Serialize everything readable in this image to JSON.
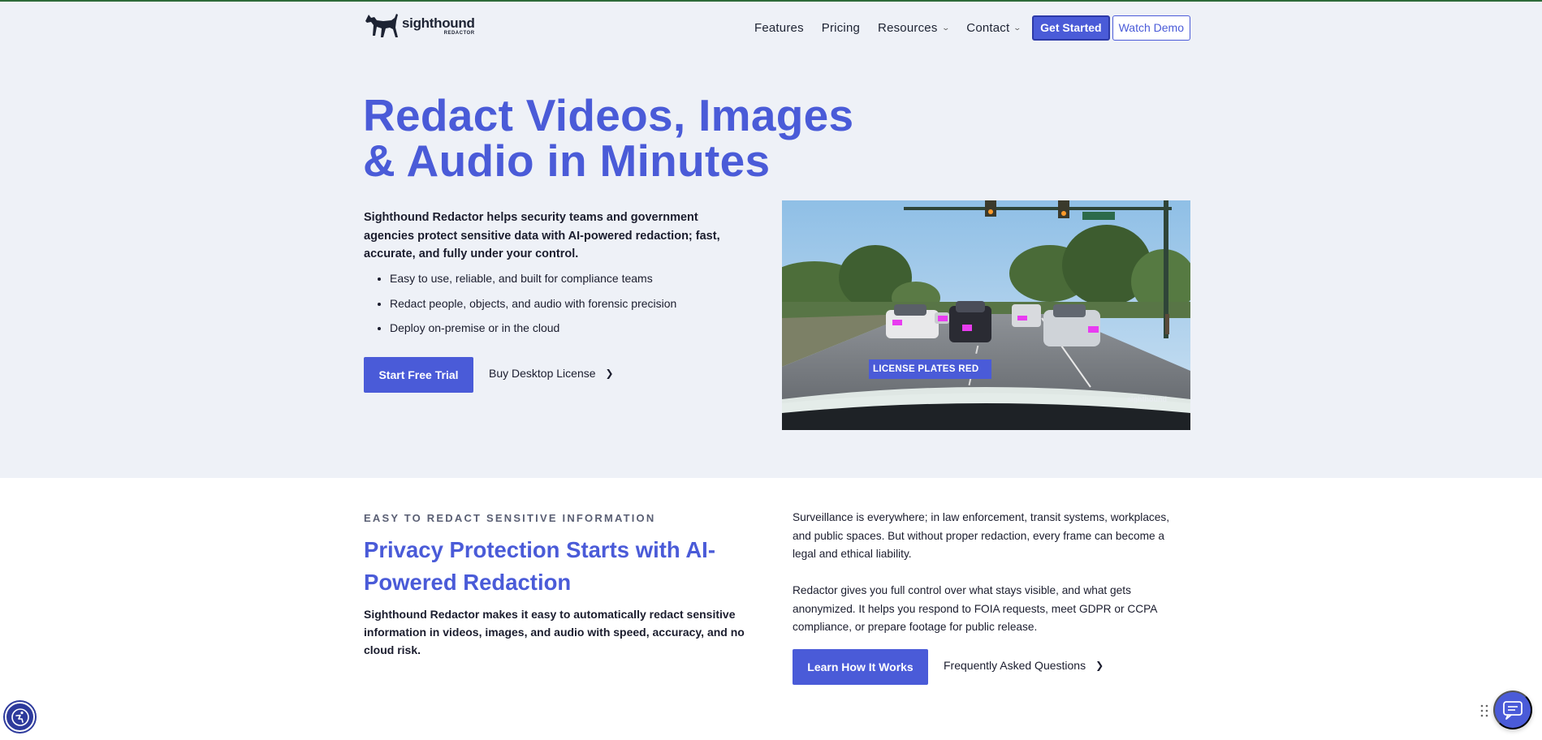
{
  "brand": {
    "name": "sighthound",
    "product": "REDACTOR",
    "logo_icon": "dog-logo-icon"
  },
  "nav": {
    "links": [
      {
        "label": "Features",
        "has_dropdown": false
      },
      {
        "label": "Pricing",
        "has_dropdown": false
      },
      {
        "label": "Resources",
        "has_dropdown": true
      },
      {
        "label": "Contact",
        "has_dropdown": true
      }
    ],
    "get_started": "Get Started",
    "watch_demo": "Watch Demo"
  },
  "hero": {
    "title_line1": "Redact Videos, Images",
    "title_line2": "& Audio in Minutes",
    "intro": "Sighthound Redactor helps security teams and government agencies protect sensitive data with AI-powered redaction; fast, accurate, and fully under your control.",
    "bullets": [
      "Easy to use, reliable, and built for compliance teams",
      "Redact people, objects, and audio with forensic precision",
      "Deploy on-premise or in the cloud"
    ],
    "primary_cta": "Start Free Trial",
    "secondary_cta": "Buy Desktop License",
    "video_caption": "LICENSE PLATES RED"
  },
  "section2": {
    "eyebrow": "EASY TO REDACT SENSITIVE INFORMATION",
    "title_line1": "Privacy Protection Starts with AI-",
    "title_line2": "Powered Redaction",
    "description": "Sighthound Redactor makes it easy to automatically redact sensitive information in videos, images, and audio with speed, accuracy, and no cloud risk.",
    "paragraph1": "Surveillance is everywhere; in law enforcement, transit systems, workplaces, and public spaces. But without proper redaction, every frame can become a legal and ethical liability.",
    "paragraph2": "Redactor gives you full control over what stays visible, and what gets anonymized. It helps you respond to FOIA requests, meet GDPR or CCPA compliance, or prepare footage for public release.",
    "primary_cta": "Learn How It Works",
    "secondary_cta": "Frequently Asked Questions"
  },
  "colors": {
    "accent": "#4a5bd8",
    "hero_bg": "#eef1f7",
    "text": "#1b1d2e",
    "redaction_box": "#e83cf0"
  },
  "floating": {
    "accessibility_icon": "accessibility-icon",
    "chat_icon": "chat-icon"
  }
}
